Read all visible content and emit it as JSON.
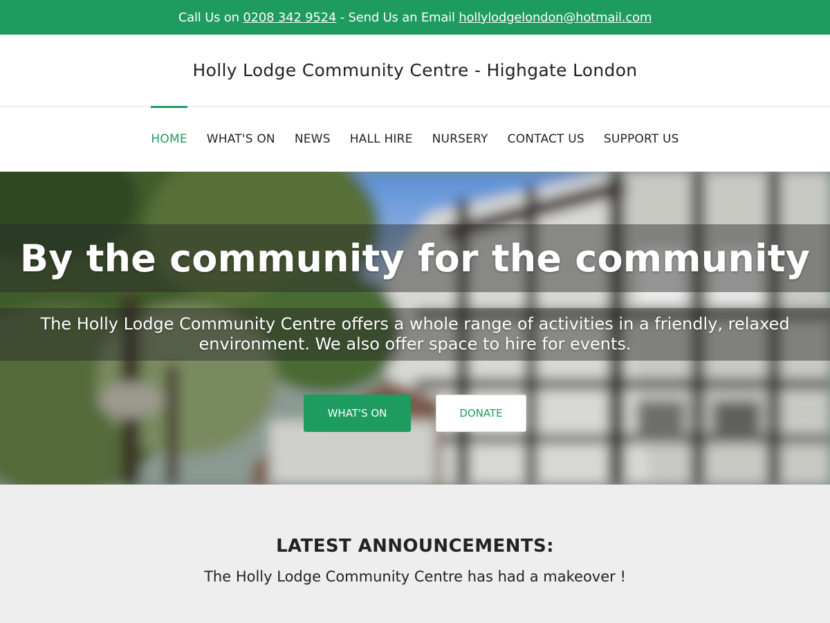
{
  "topbar": {
    "call_prefix": "Call Us on ",
    "phone": "0208 342 9524",
    "email_prefix": " - Send Us an Email ",
    "email": "hollylodgelondon@hotmail.com"
  },
  "site": {
    "title": "Holly Lodge Community Centre - Highgate London"
  },
  "nav": {
    "items": [
      {
        "label": "HOME",
        "active": true
      },
      {
        "label": "WHAT'S ON"
      },
      {
        "label": "NEWS"
      },
      {
        "label": "HALL HIRE"
      },
      {
        "label": "NURSERY"
      },
      {
        "label": "CONTACT US"
      },
      {
        "label": "SUPPORT US"
      }
    ]
  },
  "hero": {
    "heading": "By the community for the community",
    "subheading": "The Holly Lodge Community Centre offers a whole range of activities in a friendly, relaxed environment. We also offer space to hire for events.",
    "primary_button": "WHAT'S ON",
    "secondary_button": "DONATE"
  },
  "announcements": {
    "title": "LATEST ANNOUNCEMENTS:",
    "text": "The Holly Lodge Community Centre has had a makeover !"
  },
  "colors": {
    "accent": "#1e9b5f",
    "announce_bg": "#eeeeee"
  }
}
